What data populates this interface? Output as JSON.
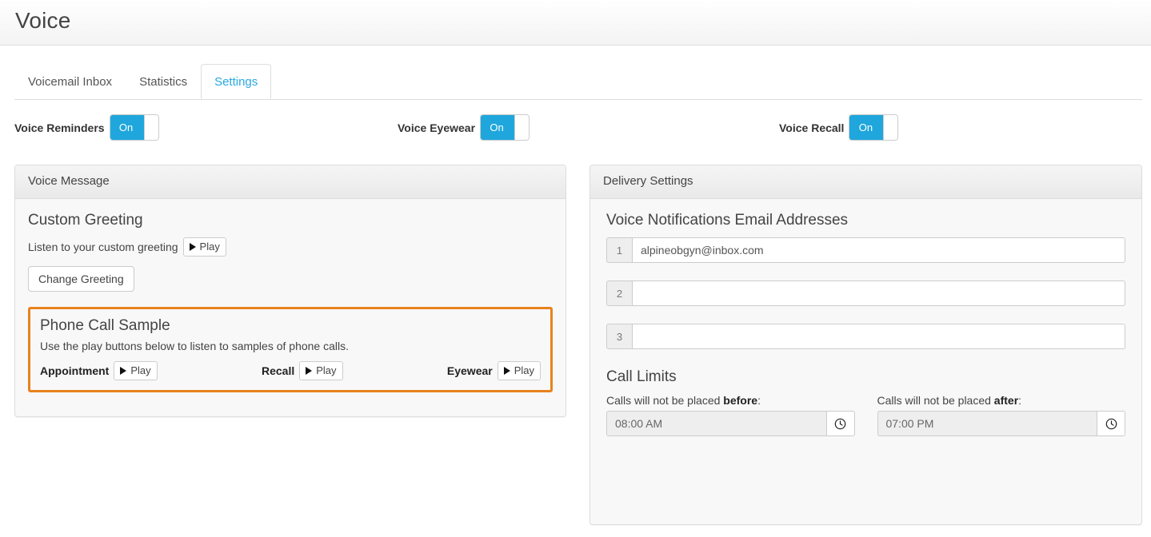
{
  "header": {
    "title": "Voice"
  },
  "tabs": [
    {
      "label": "Voicemail Inbox",
      "active": false
    },
    {
      "label": "Statistics",
      "active": false
    },
    {
      "label": "Settings",
      "active": true
    }
  ],
  "toggles": [
    {
      "label": "Voice Reminders",
      "state": "On",
      "icon": "toggle-switch-icon"
    },
    {
      "label": "Voice Eyewear",
      "state": "On",
      "icon": "toggle-switch-icon"
    },
    {
      "label": "Voice Recall",
      "state": "On",
      "icon": "toggle-switch-icon"
    }
  ],
  "voice_message": {
    "panel_title": "Voice Message",
    "custom_greeting": {
      "title": "Custom Greeting",
      "listen_text": "Listen to your custom greeting",
      "play_label": "Play",
      "change_button": "Change Greeting"
    },
    "phone_call_sample": {
      "title": "Phone Call Sample",
      "hint": "Use the play buttons below to listen to samples of phone calls.",
      "samples": [
        {
          "name": "Appointment",
          "play_label": "Play"
        },
        {
          "name": "Recall",
          "play_label": "Play"
        },
        {
          "name": "Eyewear",
          "play_label": "Play"
        }
      ],
      "highlight_color": "#e8821e"
    }
  },
  "delivery_settings": {
    "panel_title": "Delivery Settings",
    "emails": {
      "title": "Voice Notifications Email Addresses",
      "rows": [
        {
          "index": "1",
          "value": "alpineobgyn@inbox.com",
          "placeholder": ""
        },
        {
          "index": "2",
          "value": "",
          "placeholder": ""
        },
        {
          "index": "3",
          "value": "",
          "placeholder": ""
        }
      ]
    },
    "call_limits": {
      "title": "Call Limits",
      "before": {
        "label_prefix": "Calls will not be placed ",
        "label_bold": "before",
        "label_suffix": ":",
        "value": "08:00 AM",
        "icon": "clock-icon"
      },
      "after": {
        "label_prefix": "Calls will not be placed ",
        "label_bold": "after",
        "label_suffix": ":",
        "value": "07:00 PM",
        "icon": "clock-icon"
      }
    }
  },
  "colors": {
    "accent": "#28a8e0",
    "toggle_on": "#1fa7dd",
    "highlight": "#e8821e"
  }
}
